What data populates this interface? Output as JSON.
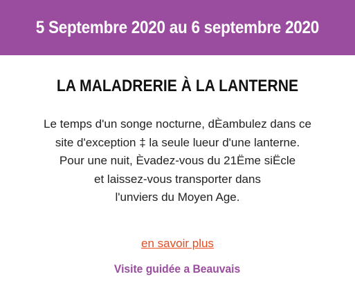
{
  "banner": {
    "dates": "5 Septembre 2020 au 6 septembre 2020",
    "background_color": "#9a4c9e"
  },
  "event": {
    "title": "LA MALADRERIE À LA LANTERNE",
    "description_lines": [
      "Le temps d'un songe nocturne, dÈambulez dans ce",
      "site d'exception ‡ la seule lueur d'une lanterne.",
      "Pour une nuit, Èvadez-vous du 21Ëme siËcle",
      "et laissez-vous transporter dans",
      "l'unviers du Moyen Age."
    ],
    "learn_more_label": "en savoir plus",
    "link_color": "#e84a1c",
    "guided_visit": "Visite guidée a Beauvais"
  }
}
